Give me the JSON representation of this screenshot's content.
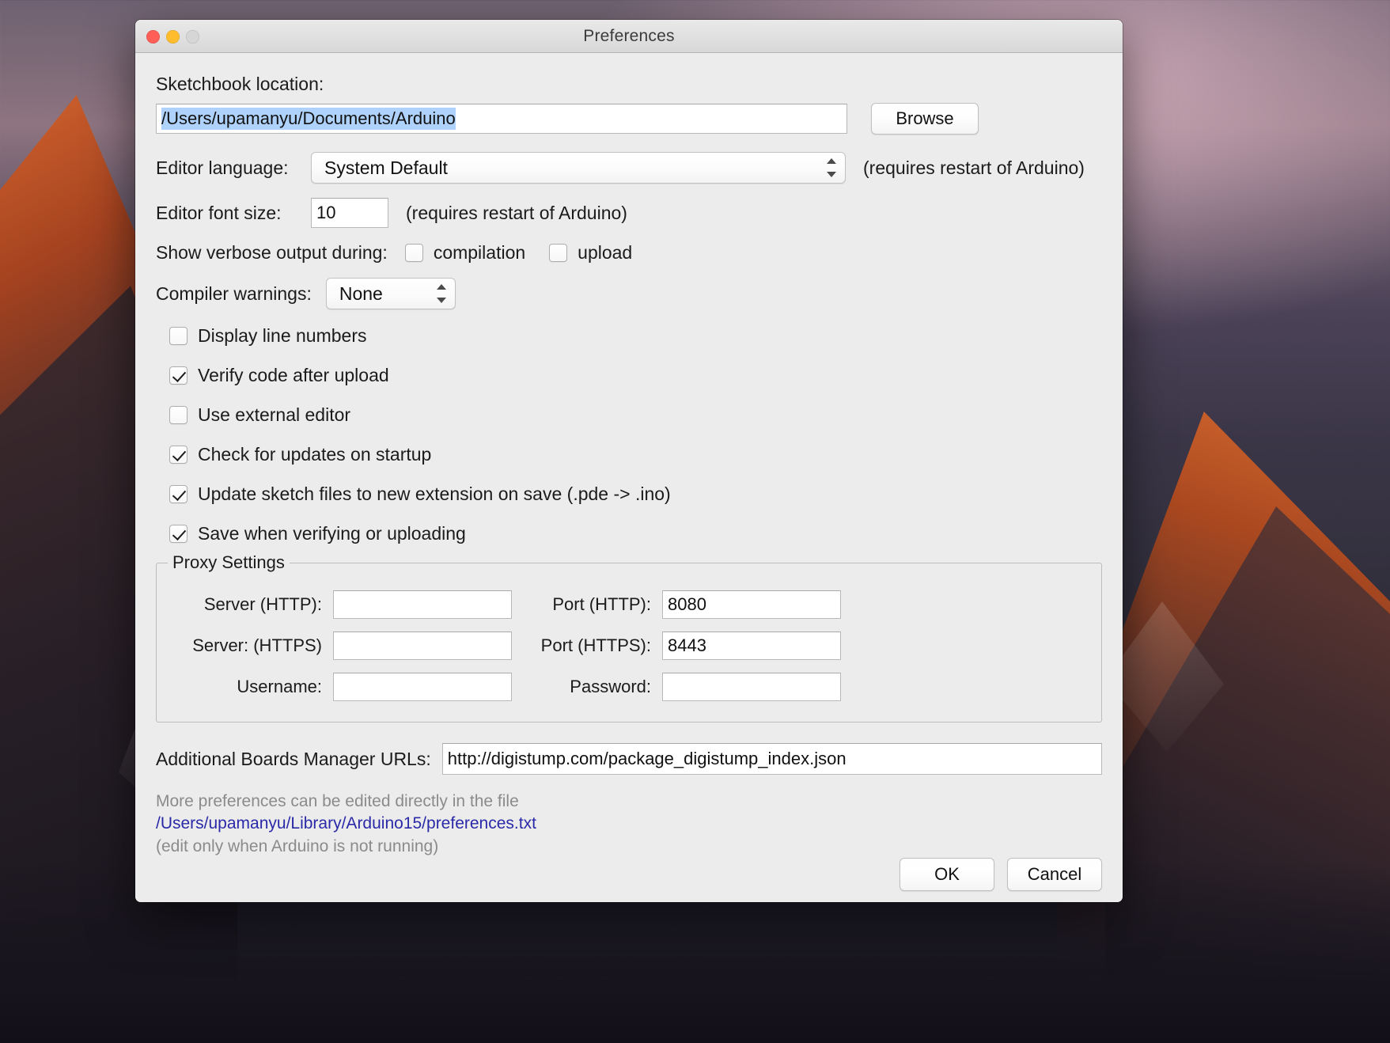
{
  "window": {
    "title": "Preferences",
    "traffic_lights": [
      "close-button",
      "minimize-button",
      "zoom-button"
    ]
  },
  "sketchbook": {
    "label": "Sketchbook location:",
    "value": "/Users/upamanyu/Documents/Arduino",
    "browse_label": "Browse"
  },
  "editor_language": {
    "label": "Editor language:",
    "value": "System Default",
    "note": "(requires restart of Arduino)"
  },
  "editor_font_size": {
    "label": "Editor font size:",
    "value": "10",
    "note": "(requires restart of Arduino)"
  },
  "verbose": {
    "label": "Show verbose output during:",
    "options": [
      {
        "label": "compilation",
        "checked": false
      },
      {
        "label": "upload",
        "checked": false
      }
    ]
  },
  "compiler_warnings": {
    "label": "Compiler warnings:",
    "value": "None"
  },
  "checkboxes": [
    {
      "label": "Display line numbers",
      "checked": false
    },
    {
      "label": "Verify code after upload",
      "checked": true
    },
    {
      "label": "Use external editor",
      "checked": false
    },
    {
      "label": "Check for updates on startup",
      "checked": true
    },
    {
      "label": "Update sketch files to new extension on save (.pde -> .ino)",
      "checked": true
    },
    {
      "label": "Save when verifying or uploading",
      "checked": true
    }
  ],
  "proxy": {
    "title": "Proxy Settings",
    "rows": [
      {
        "left_label": "Server (HTTP):",
        "left_value": "",
        "right_label": "Port (HTTP):",
        "right_value": "8080"
      },
      {
        "left_label": "Server: (HTTPS)",
        "left_value": "",
        "right_label": "Port (HTTPS):",
        "right_value": "8443"
      },
      {
        "left_label": "Username:",
        "left_value": "",
        "right_label": "Password:",
        "right_value": ""
      }
    ]
  },
  "boards_urls": {
    "label": "Additional Boards Manager URLs:",
    "value": "http://digistump.com/package_digistump_index.json"
  },
  "footer": {
    "line1": "More preferences can be edited directly in the file",
    "path": "/Users/upamanyu/Library/Arduino15/preferences.txt",
    "line3": "(edit only when Arduino is not running)"
  },
  "actions": {
    "ok": "OK",
    "cancel": "Cancel"
  },
  "colors": {
    "selection": "#aed2fb",
    "link": "#2a2aa8",
    "window_bg": "#ececec"
  }
}
